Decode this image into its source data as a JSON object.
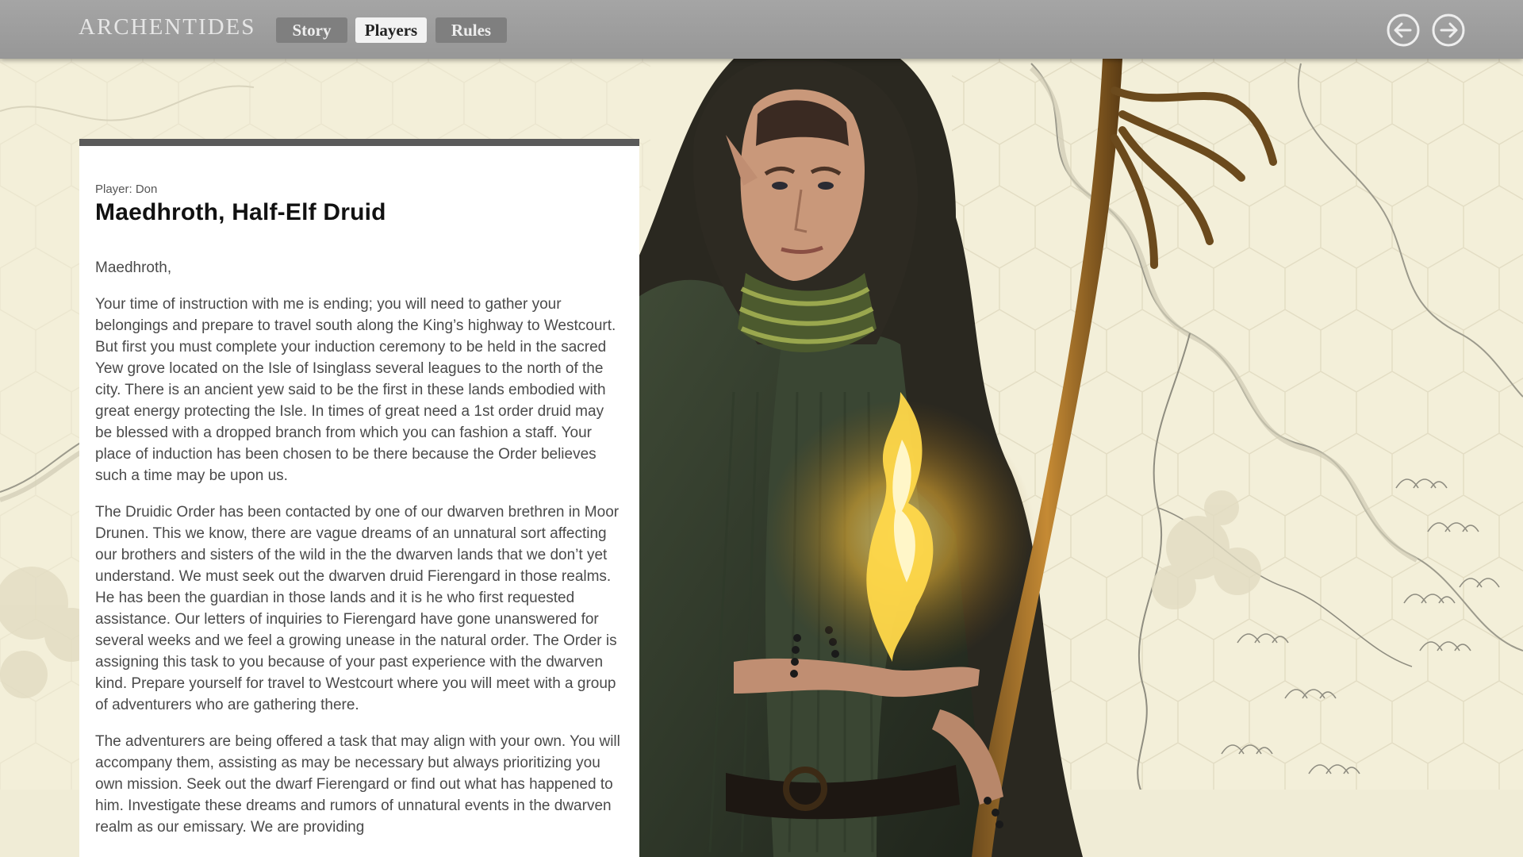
{
  "app": {
    "logo_text": "ARCHENTIDES"
  },
  "nav": {
    "tabs": [
      {
        "label": "Story",
        "active": false
      },
      {
        "label": "Players",
        "active": true
      },
      {
        "label": "Rules",
        "active": false
      }
    ],
    "prev_icon": "arrow-left-circle-icon",
    "next_icon": "arrow-right-circle-icon"
  },
  "letter": {
    "player_label": "Player: Don",
    "title": "Maedhroth, Half-Elf Druid",
    "greeting": "Maedhroth,",
    "paragraphs": [
      "Your time of instruction with me is ending; you will need to gather your belongings and prepare to travel south along the King’s highway to Westcourt. But first you must complete your induction ceremony to be held in the sacred Yew grove located on the Isle of Isinglass several leagues to the north of the city. There is an ancient yew said to be the first in these lands embodied with great energy protecting the Isle. In times of great need a 1st order druid may be blessed with a dropped branch from which you can fashion a staff. Your place of induction has been chosen to be there because the Order believes such a time may be upon us.",
      "The Druidic Order has been contacted by one of our dwarven brethren in Moor Drunen. This we know, there are vague dreams of an unnatural sort affecting our brothers and sisters of the wild in the the dwarven lands that we don’t yet understand. We must seek out the dwarven druid Fierengard in those realms. He has been the guardian in those lands and it is he who first requested assistance. Our letters of inquiries to Fierengard have gone unanswered for several weeks and we feel a growing unease in the natural order. The Order is assigning this task to you because of your past experience with the dwarven kind. Prepare yourself for travel to Westcourt where you will meet with a group of adventurers who are gathering there.",
      "The adventurers are being offered a task that may align with your own. You will accompany them, assisting as may be necessary but always prioritizing you own mission. Seek out the dwarf Fierengard or find out what has happened to him. Investigate these dreams and rumors of unnatural events in the dwarven realm as our emissary. We are providing"
    ]
  },
  "colors": {
    "topbar": "#9e9e9e",
    "tab_active_bg": "#f2f2f2",
    "tab_inactive_bg": "#7f7f7f",
    "panel_border": "#5a5a5a",
    "background": "#f3efd9"
  }
}
